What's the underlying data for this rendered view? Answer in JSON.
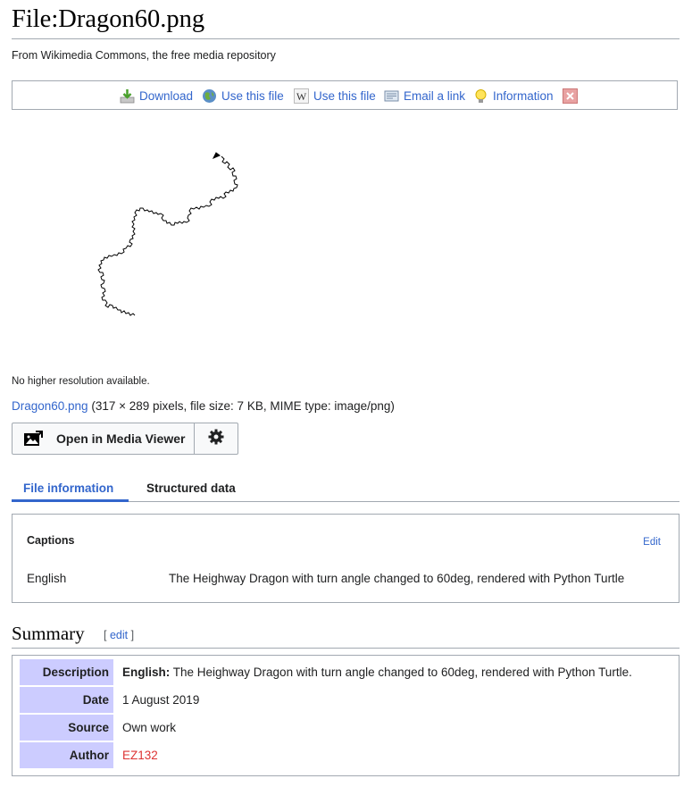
{
  "page": {
    "title": "File:Dragon60.png",
    "tagline": "From Wikimedia Commons, the free media repository"
  },
  "toolbar": {
    "download": "Download",
    "use_this_file_1": "Use this file",
    "use_this_file_2": "Use this file",
    "email_link": "Email a link",
    "information": "Information"
  },
  "preview": {
    "no_higher_res": "No higher resolution available.",
    "file_link": "Dragon60.png",
    "file_details": "(317 × 289 pixels, file size: 7 KB, MIME type: image/png)"
  },
  "media_viewer": {
    "open_label": "Open in Media Viewer"
  },
  "tabs": {
    "file_information": "File information",
    "structured_data": "Structured data"
  },
  "captions": {
    "title": "Captions",
    "edit": "Edit",
    "language": "English",
    "text": "The Heighway Dragon with turn angle changed to 60deg, rendered with Python Turtle"
  },
  "summary": {
    "heading": "Summary",
    "edit_open": "[ ",
    "edit_label": "edit",
    "edit_close": " ]",
    "rows": {
      "description_label": "Description",
      "description_lang": "English:",
      "description_value": " The Heighway Dragon with turn angle changed to 60deg, rendered with Python Turtle.",
      "date_label": "Date",
      "date_value": "1 August 2019",
      "source_label": "Source",
      "source_value": "Own work",
      "author_label": "Author",
      "author_value": "EZ132"
    }
  },
  "colors": {
    "link": "#3366cc",
    "red_link": "#dd3333",
    "summary_label_bg": "#ccccff",
    "border": "#a2a9b1"
  }
}
